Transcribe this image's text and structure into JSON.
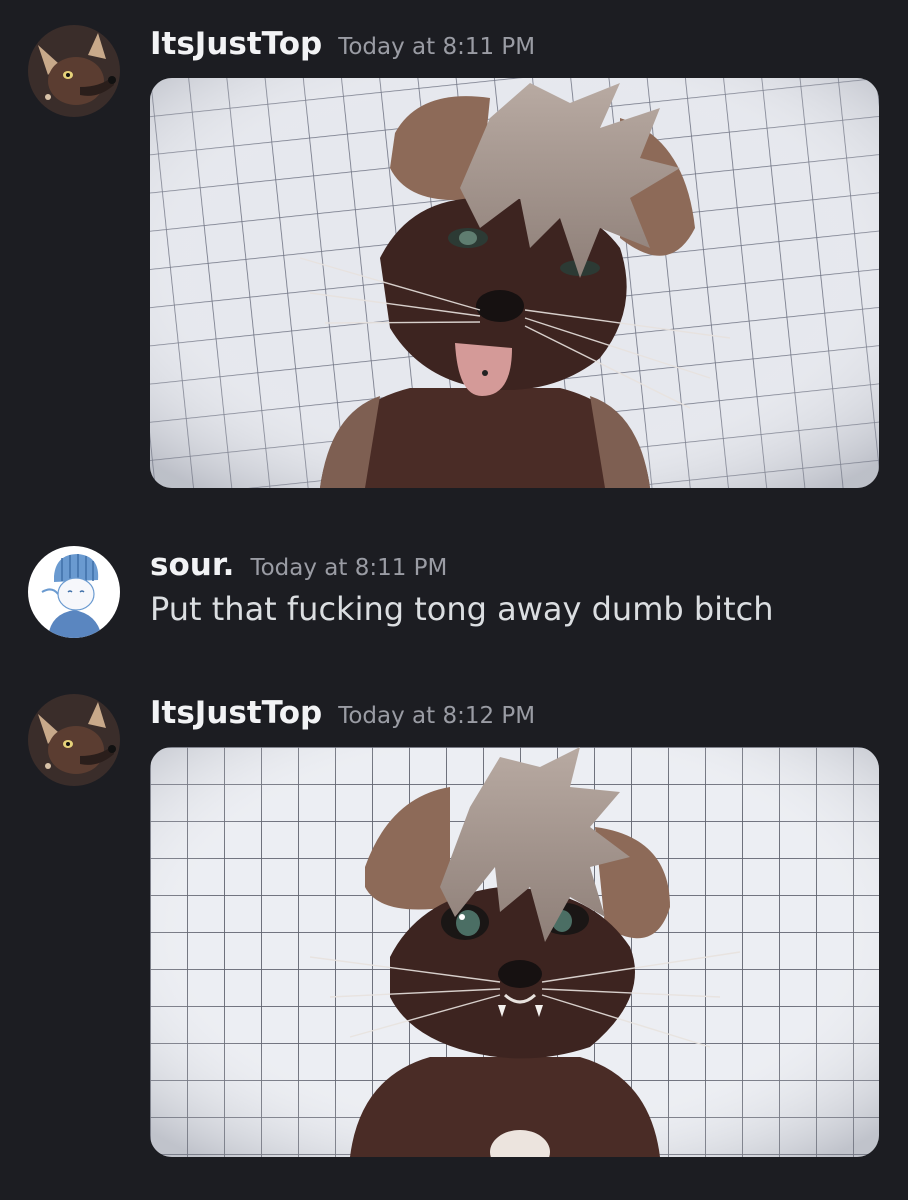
{
  "messages": [
    {
      "username": "ItsJustTop",
      "timestamp": "Today at 8:11 PM",
      "attachment_icon": "image-attachment"
    },
    {
      "username": "sour.",
      "timestamp": "Today at 8:11 PM",
      "content": "Put that fucking tong away dumb bitch"
    },
    {
      "username": "ItsJustTop",
      "timestamp": "Today at 8:12 PM",
      "attachment_icon": "image-attachment"
    }
  ],
  "colors": {
    "background": "#1c1d22",
    "username": "#f2f3f5",
    "timestamp": "#9a9ca4",
    "message_text": "#dbdee1"
  }
}
